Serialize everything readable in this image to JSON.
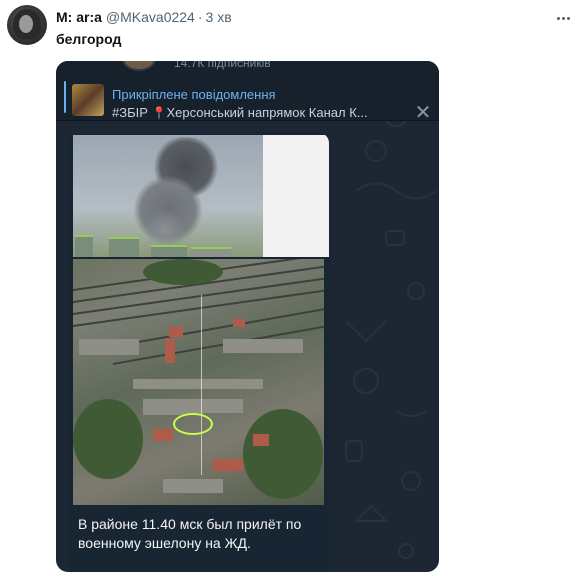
{
  "tweet": {
    "author_name": "M: ar:a",
    "handle": "@MKava0224",
    "separator": "·",
    "time": "3 хв",
    "text": "белгород",
    "more_icon": "more-dots-icon"
  },
  "telegram": {
    "channel_subscribers": "14.7К підписників",
    "pinned": {
      "title": "Прикріплене повідомлення",
      "text_prefix": "#ЗБІР",
      "pin_icon": "📍",
      "text_rest": "Херсонський напрямок   Канал К...",
      "close_icon": "✕"
    },
    "message": {
      "caption": "В районе 11.40 мск был прилёт по военному эшелону на ЖД."
    }
  },
  "colors": {
    "name": "#0f1419",
    "secondary": "#536471",
    "telegram_bg": "#1d2733",
    "telegram_accent": "#6ab2f2"
  }
}
